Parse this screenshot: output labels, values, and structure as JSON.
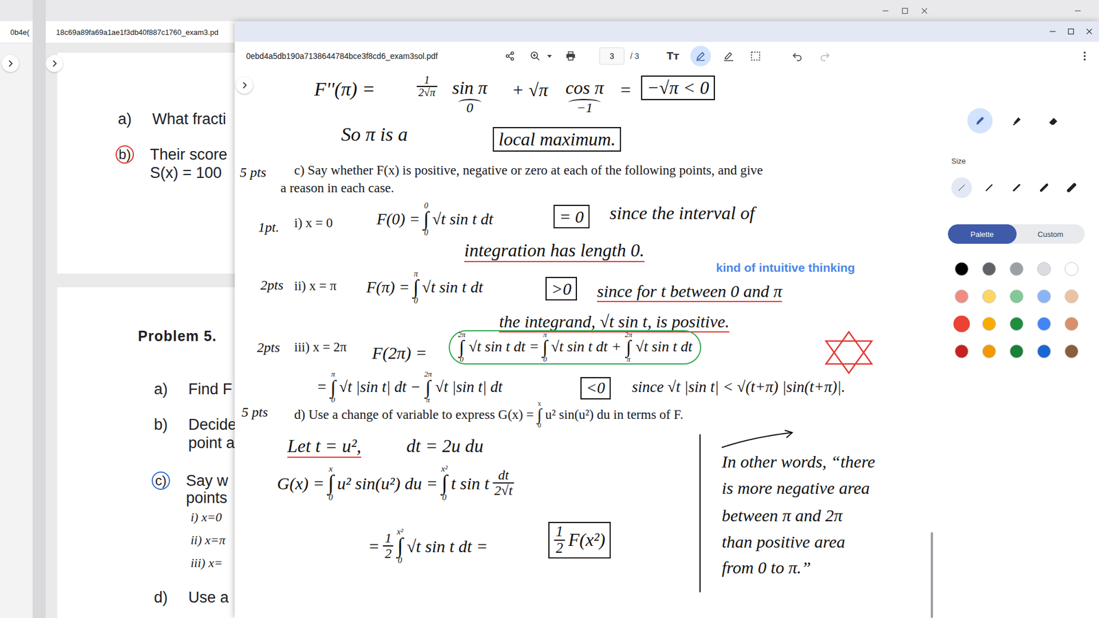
{
  "window": {
    "title": "0ebd4a5db190a7138644784bce3f8cd6_exam3sol.pdf",
    "page": "3",
    "pages": "/ 3",
    "text_tool": "Tт"
  },
  "toolbar": {
    "annotate_selected": true,
    "redo_disabled": true
  },
  "back_windows": [
    {
      "tab": "0b4e("
    },
    {
      "tab": "18c69a89fa69a1ae1f3db40f887c1760_exam3.pd"
    }
  ],
  "back_document": {
    "card1": [
      {
        "label": "a)",
        "lines": [
          "What fracti"
        ],
        "circled": false,
        "color": "#000000"
      },
      {
        "label": "b)",
        "lines": [
          "Their score",
          "S(x) = 100"
        ],
        "circled": true,
        "color": "#e0362c"
      }
    ],
    "heading": "Problem 5.",
    "card2": [
      {
        "label": "a)",
        "lines": [
          "Find F"
        ],
        "circled": false,
        "color": "#000000",
        "sub": []
      },
      {
        "label": "b)",
        "lines": [
          "Decide",
          "point a"
        ],
        "circled": false,
        "color": "#000000",
        "sub": []
      },
      {
        "label": "c)",
        "lines": [
          "Say w",
          "points"
        ],
        "circled": true,
        "color": "#2f6fd6",
        "sub": [
          "i) x=0",
          "ii) x=π",
          "iii) x="
        ]
      },
      {
        "label": "d)",
        "lines": [
          "Use a"
        ],
        "circled": false,
        "color": "#000000",
        "sub": []
      }
    ]
  },
  "document": {
    "items": [
      {
        "style": "ink",
        "box": false,
        "underline": false,
        "ring": false,
        "segs": [
          {
            "t": "F''(π) ="
          }
        ]
      },
      {
        "style": "ink",
        "box": false,
        "underline": false,
        "ring": false,
        "segs": [
          {
            "num": "1",
            "den": "2√π"
          }
        ]
      },
      {
        "style": "ink",
        "box": false,
        "underline": false,
        "ring": false,
        "segs": [
          {
            "t": "sin π",
            "brace": "0"
          }
        ]
      },
      {
        "style": "ink",
        "box": false,
        "underline": false,
        "ring": false,
        "segs": [
          {
            "t": "+ √π"
          }
        ]
      },
      {
        "style": "ink",
        "box": false,
        "underline": false,
        "ring": false,
        "segs": [
          {
            "t": "cos π",
            "brace": "−1"
          }
        ]
      },
      {
        "style": "ink",
        "box": false,
        "underline": false,
        "ring": false,
        "segs": [
          {
            "t": "="
          }
        ]
      },
      {
        "style": "ink",
        "box": true,
        "underline": false,
        "ring": false,
        "segs": [
          {
            "t": "−√π < 0"
          }
        ]
      },
      {
        "style": "ink",
        "box": false,
        "underline": false,
        "ring": false,
        "segs": [
          {
            "t": "So π is a"
          }
        ]
      },
      {
        "style": "ink",
        "box": true,
        "underline": false,
        "ring": false,
        "segs": [
          {
            "t": "local maximum."
          }
        ]
      },
      {
        "style": "points",
        "box": false,
        "underline": false,
        "ring": false,
        "segs": [
          {
            "t": "5 pts"
          }
        ]
      },
      {
        "style": "print",
        "box": false,
        "underline": false,
        "ring": false,
        "segs": [
          {
            "t": "c) Say whether F(x) is positive, negative or zero at each of the following points, and give"
          }
        ]
      },
      {
        "style": "print",
        "box": false,
        "underline": false,
        "ring": false,
        "segs": [
          {
            "t": "a reason in each case."
          }
        ]
      },
      {
        "style": "points",
        "box": false,
        "underline": false,
        "ring": false,
        "segs": [
          {
            "t": "1pt."
          }
        ]
      },
      {
        "style": "print",
        "box": false,
        "underline": false,
        "ring": false,
        "segs": [
          {
            "t": "i) x = 0"
          }
        ]
      },
      {
        "style": "ink",
        "box": false,
        "underline": false,
        "ring": false,
        "segs": [
          {
            "t": "F(0) ="
          },
          {
            "sign": "∫",
            "lo": "0",
            "hi": "0"
          },
          {
            "t": "√t sin t dt"
          }
        ]
      },
      {
        "style": "ink",
        "box": true,
        "underline": false,
        "ring": false,
        "segs": [
          {
            "t": "= 0"
          }
        ]
      },
      {
        "style": "ink",
        "box": false,
        "underline": false,
        "ring": false,
        "segs": [
          {
            "t": "since the interval of"
          }
        ]
      },
      {
        "style": "ink",
        "box": false,
        "underline": true,
        "ring": false,
        "segs": [
          {
            "t": "integration has length 0."
          }
        ]
      },
      {
        "style": "points",
        "box": false,
        "underline": false,
        "ring": false,
        "segs": [
          {
            "t": "2pts"
          }
        ]
      },
      {
        "style": "print",
        "box": false,
        "underline": false,
        "ring": false,
        "segs": [
          {
            "t": "ii) x = π"
          }
        ]
      },
      {
        "style": "ink",
        "box": false,
        "underline": false,
        "ring": false,
        "segs": [
          {
            "t": "F(π) ="
          },
          {
            "sign": "∫",
            "lo": "0",
            "hi": "π"
          },
          {
            "t": "√t sin t dt"
          }
        ]
      },
      {
        "style": "ink",
        "box": true,
        "underline": false,
        "ring": false,
        "segs": [
          {
            "t": ">0"
          }
        ]
      },
      {
        "style": "ink",
        "box": false,
        "underline": true,
        "ring": false,
        "segs": [
          {
            "t": "since for t between 0 and π"
          }
        ]
      },
      {
        "style": "ink",
        "box": false,
        "underline": true,
        "ring": false,
        "segs": [
          {
            "t": "the integrand, √t sin t, is positive."
          }
        ]
      },
      {
        "style": "remark",
        "box": false,
        "underline": false,
        "ring": false,
        "segs": [
          {
            "t": "kind of intuitive thinking"
          }
        ]
      },
      {
        "style": "points",
        "box": false,
        "underline": false,
        "ring": false,
        "segs": [
          {
            "t": "2pts"
          }
        ]
      },
      {
        "style": "print",
        "box": false,
        "underline": false,
        "ring": false,
        "segs": [
          {
            "t": "iii) x = 2π"
          }
        ]
      },
      {
        "style": "ink",
        "box": false,
        "underline": false,
        "ring": false,
        "segs": [
          {
            "t": "F(2π) ="
          }
        ]
      },
      {
        "style": "ink",
        "box": false,
        "underline": false,
        "ring": true,
        "segs": [
          {
            "sign": "∫",
            "lo": "0",
            "hi": "2π"
          },
          {
            "t": "√t sin t dt ="
          },
          {
            "sign": "∫",
            "lo": "0",
            "hi": "π"
          },
          {
            "t": "√t sin t dt +"
          },
          {
            "sign": "∫",
            "lo": "π",
            "hi": "2π"
          },
          {
            "t": "√t sin t dt"
          }
        ]
      },
      {
        "style": "ink",
        "box": false,
        "underline": false,
        "ring": false,
        "segs": [
          {
            "t": "="
          },
          {
            "sign": "∫",
            "lo": "0",
            "hi": "π"
          },
          {
            "t": "√t |sin t| dt −"
          },
          {
            "sign": "∫",
            "lo": "π",
            "hi": "2π"
          },
          {
            "t": "√t |sin t| dt"
          }
        ]
      },
      {
        "style": "ink",
        "box": true,
        "underline": false,
        "ring": false,
        "segs": [
          {
            "t": "<0"
          }
        ]
      },
      {
        "style": "ink",
        "box": false,
        "underline": false,
        "ring": false,
        "segs": [
          {
            "t": "since √t |sin t| < √(t+π) |sin(t+π)|."
          }
        ]
      },
      {
        "style": "points",
        "box": false,
        "underline": false,
        "ring": false,
        "segs": [
          {
            "t": "5 pts"
          }
        ]
      },
      {
        "style": "print",
        "box": false,
        "underline": false,
        "ring": false,
        "segs": [
          {
            "t": "d) Use a change of variable to express G(x) ="
          },
          {
            "sign": "∫",
            "lo": "0",
            "hi": "x"
          },
          {
            "t": "u² sin(u²) du in terms of F."
          }
        ]
      },
      {
        "style": "ink",
        "box": false,
        "underline": true,
        "ring": false,
        "segs": [
          {
            "t": "Let t = u²,"
          }
        ]
      },
      {
        "style": "ink",
        "box": false,
        "underline": false,
        "ring": false,
        "segs": [
          {
            "t": "dt = 2u du"
          }
        ]
      },
      {
        "style": "ink",
        "box": false,
        "underline": false,
        "ring": false,
        "segs": [
          {
            "t": "G(x) ="
          },
          {
            "sign": "∫",
            "lo": "0",
            "hi": "x"
          },
          {
            "t": "u² sin(u²) du ="
          },
          {
            "sign": "∫",
            "lo": "0",
            "hi": "x²"
          },
          {
            "t": "t sin t"
          },
          {
            "num": "dt",
            "den": "2√t"
          }
        ]
      },
      {
        "style": "ink",
        "box": false,
        "underline": false,
        "ring": false,
        "segs": [
          {
            "t": "="
          },
          {
            "num": "1",
            "den": "2"
          },
          {
            "sign": "∫",
            "lo": "0",
            "hi": "x²"
          },
          {
            "t": "√t sin t dt ="
          }
        ]
      },
      {
        "style": "ink",
        "box": true,
        "underline": false,
        "ring": false,
        "segs": [
          {
            "num": "1",
            "den": "2"
          },
          {
            "t": "F(x²)"
          }
        ]
      },
      {
        "style": "ink",
        "box": false,
        "underline": false,
        "ring": false,
        "segs": [
          {
            "t": "In other words, “there"
          }
        ]
      },
      {
        "style": "ink",
        "box": false,
        "underline": false,
        "ring": false,
        "segs": [
          {
            "t": "is more negative area"
          }
        ]
      },
      {
        "style": "ink",
        "box": false,
        "underline": false,
        "ring": false,
        "segs": [
          {
            "t": "between π and 2π"
          }
        ]
      },
      {
        "style": "ink",
        "box": false,
        "underline": false,
        "ring": false,
        "segs": [
          {
            "t": "than positive area"
          }
        ]
      },
      {
        "style": "ink",
        "box": false,
        "underline": false,
        "ring": false,
        "segs": [
          {
            "t": "from 0 to π.”"
          }
        ]
      }
    ]
  },
  "panel": {
    "tools": [
      {
        "kind": "pen",
        "selected": true
      },
      {
        "kind": "highlighter",
        "selected": false
      },
      {
        "kind": "eraser",
        "selected": false
      }
    ],
    "size_label": "Size",
    "sizes": [
      {
        "selected": true
      },
      {
        "selected": false
      },
      {
        "selected": false
      },
      {
        "selected": false
      },
      {
        "selected": false
      }
    ],
    "modes": [
      {
        "label": "Palette",
        "selected": true
      },
      {
        "label": "Custom",
        "selected": false
      }
    ],
    "swatches": [
      {
        "color": "#000000",
        "selected": false
      },
      {
        "color": "#5f6368",
        "selected": false
      },
      {
        "color": "#9aa0a6",
        "selected": false
      },
      {
        "color": "#dadce0",
        "selected": false
      },
      {
        "color": "#ffffff",
        "selected": false
      },
      {
        "color": "#f28b82",
        "selected": false
      },
      {
        "color": "#fdd663",
        "selected": false
      },
      {
        "color": "#81c995",
        "selected": false
      },
      {
        "color": "#8ab4f8",
        "selected": false
      },
      {
        "color": "#eec2a0",
        "selected": false
      },
      {
        "color": "#ea4335",
        "selected": true
      },
      {
        "color": "#f9ab00",
        "selected": false
      },
      {
        "color": "#1e8e3e",
        "selected": false
      },
      {
        "color": "#4285f4",
        "selected": false
      },
      {
        "color": "#d9906a",
        "selected": false
      },
      {
        "color": "#c5221f",
        "selected": false
      },
      {
        "color": "#f29900",
        "selected": false
      },
      {
        "color": "#188038",
        "selected": false
      },
      {
        "color": "#1967d2",
        "selected": false
      },
      {
        "color": "#8d5b3e",
        "selected": false
      }
    ]
  }
}
